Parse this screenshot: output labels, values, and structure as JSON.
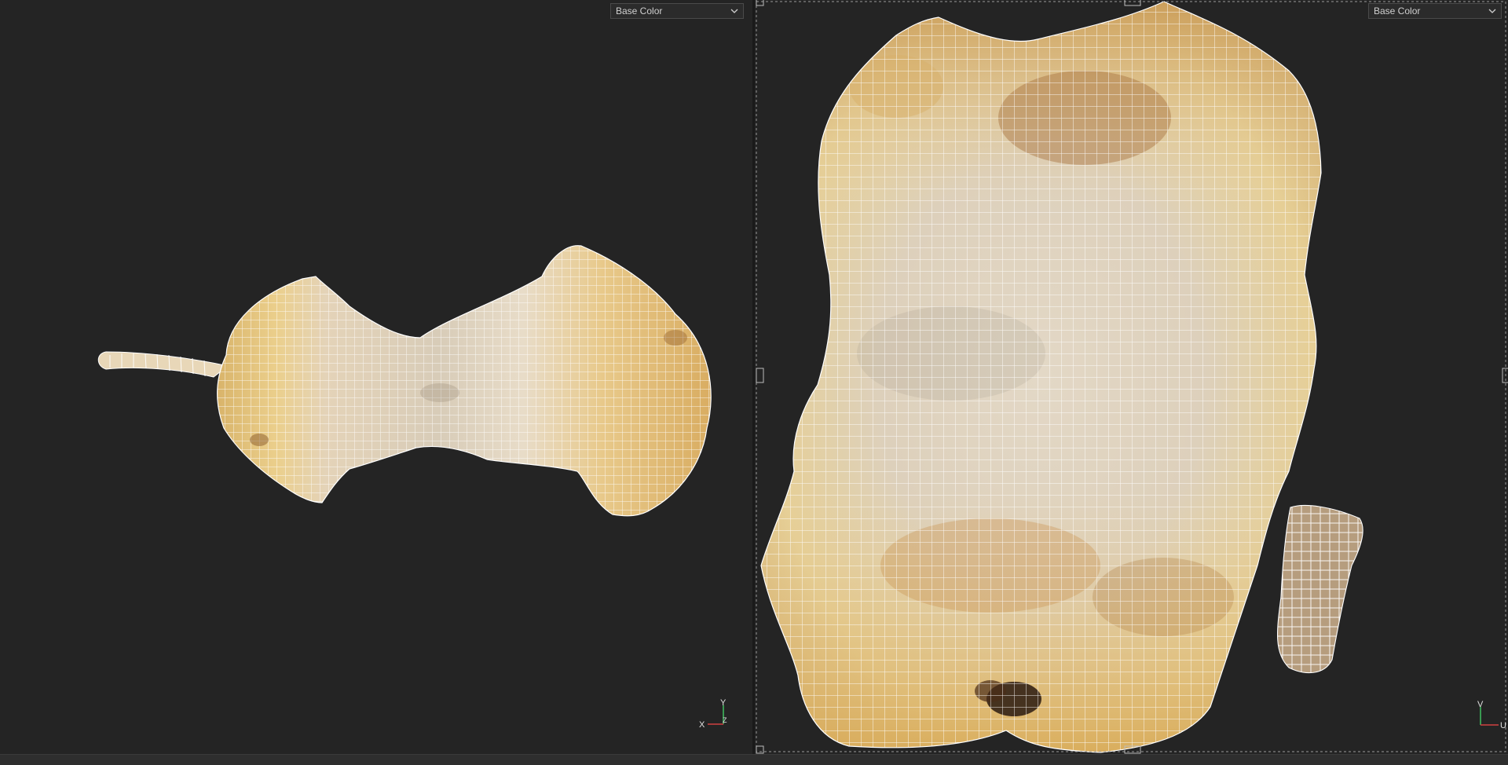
{
  "viewport_3d": {
    "channel_select": {
      "value": "Base Color",
      "options": [
        "Base Color"
      ]
    },
    "gizmo": {
      "axis_y": "Y",
      "axis_x": "X",
      "axis_z": "Z"
    }
  },
  "viewport_uv": {
    "channel_select": {
      "value": "Base Color",
      "options": [
        "Base Color"
      ]
    },
    "gizmo": {
      "axis_v": "V",
      "axis_u": "U"
    }
  },
  "colors": {
    "background": "#242424",
    "wireframe": "#ffffff",
    "texture_light": "#e6d9c0",
    "texture_yellow": "#e2c27a",
    "texture_brown": "#a6713e",
    "axis_x": "#d04040",
    "axis_y": "#40c060"
  }
}
